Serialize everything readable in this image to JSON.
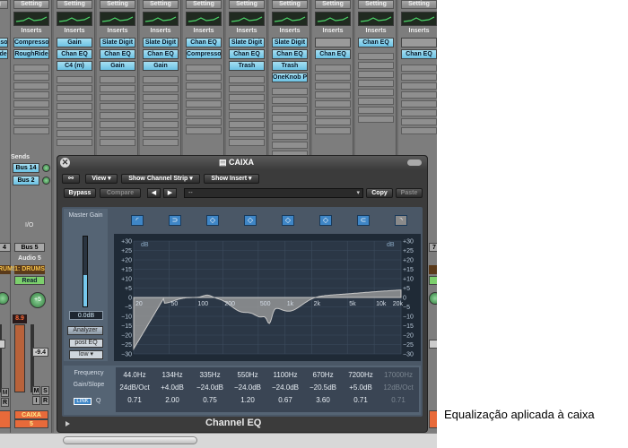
{
  "mixer": {
    "setting_label": "Setting",
    "inserts_label": "Inserts",
    "strips": [
      {
        "slots": [
          "Compresso",
          "RoughRide"
        ]
      },
      {
        "slots": [
          "Gain",
          "Chan EQ",
          "C4 (m)"
        ]
      },
      {
        "slots": [
          "Slate Digit",
          "Chan EQ",
          "Gain"
        ]
      },
      {
        "slots": [
          "Slate Digit",
          "Chan EQ",
          "Gain"
        ]
      },
      {
        "slots": [
          "Chan EQ",
          "Compresso"
        ]
      },
      {
        "slots": [
          "Slate Digit",
          "Chan EQ",
          "Trash"
        ]
      },
      {
        "slots": [
          "Slate Digit",
          "Chan EQ",
          "Trash",
          "OneKnob P"
        ]
      },
      {
        "slots": [
          "",
          "Chan EQ"
        ]
      },
      {
        "slots": [
          "Chan EQ"
        ]
      },
      {
        "slots": [
          "",
          "Chan EQ"
        ]
      }
    ],
    "sends_label": "Sends",
    "bus_14": "Bus 14",
    "bus_2": "Bus 2",
    "io_label": "I/O",
    "bus_5": "Bus 5",
    "audio_5": "Audio 5",
    "drums_left": "RUMS",
    "drums": "1: DRUMS",
    "read_label": "Read",
    "pan_value": "+5",
    "level_value": "8.9",
    "fader_value": "-9.4",
    "strip_name": "CAIXA",
    "strip_number": "5",
    "edge_number_left": "4",
    "edge_number_right": "7",
    "m_label": "M",
    "s_label": "S",
    "i_label": "I",
    "r_label": "R"
  },
  "plugin": {
    "title": "CAIXA",
    "view_label": "View",
    "show_channel_strip": "Show Channel Strip",
    "show_insert": "Show Insert",
    "bypass_label": "Bypass",
    "compare_label": "Compare",
    "preset": "--",
    "copy_label": "Copy",
    "paste_label": "Paste",
    "master_gain_label": "Master Gain",
    "master_gain_value": "0.0dB",
    "master_gain_level": 0.45,
    "analyzer_label": "Analyzer",
    "post_eq_label": "post EQ",
    "low_label": "low",
    "db_unit": "dB",
    "y_ticks": [
      "+30",
      "+25",
      "+20",
      "+15",
      "+10",
      "+5",
      "0",
      "−5",
      "−10",
      "−15",
      "−20",
      "−25",
      "−30"
    ],
    "x_ticks": [
      "20",
      "50",
      "100",
      "200",
      "500",
      "1k",
      "2k",
      "5k",
      "10k",
      "20k"
    ],
    "frequency_label": "Frequency",
    "gain_slope_label": "Gain/Slope",
    "q_label": "Q",
    "link_label": "LINK",
    "bands": [
      {
        "freq": "44.0Hz",
        "gain": "24dB/Oct",
        "q": "0.71",
        "on": true
      },
      {
        "freq": "134Hz",
        "gain": "+4.0dB",
        "q": "2.00",
        "on": true
      },
      {
        "freq": "335Hz",
        "gain": "−24.0dB",
        "q": "0.75",
        "on": true
      },
      {
        "freq": "550Hz",
        "gain": "−24.0dB",
        "q": "1.20",
        "on": true
      },
      {
        "freq": "1100Hz",
        "gain": "−24.0dB",
        "q": "0.67",
        "on": true
      },
      {
        "freq": "670Hz",
        "gain": "−20.5dB",
        "q": "3.60",
        "on": true
      },
      {
        "freq": "7200Hz",
        "gain": "+5.0dB",
        "q": "0.71",
        "on": true
      },
      {
        "freq": "17000Hz",
        "gain": "12dB/Oct",
        "q": "0.71",
        "on": false
      }
    ],
    "plugin_name": "Channel EQ",
    "accent_color": "#3f86c6"
  },
  "caption": "Equalização aplicada à caixa"
}
